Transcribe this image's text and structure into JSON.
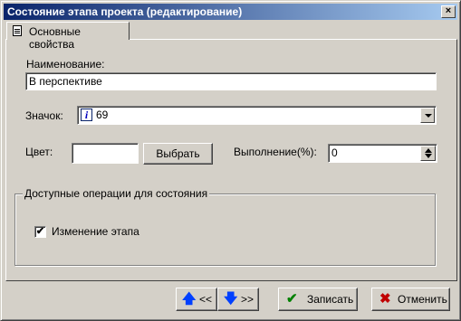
{
  "window": {
    "title": "Состояние этапа проекта (редактирование)",
    "close_glyph": "×"
  },
  "tabs": [
    {
      "label": "Основные свойства"
    }
  ],
  "form": {
    "name_label": "Наименование:",
    "name_value": "В перспективе",
    "icon_label": "Значок:",
    "icon_glyph": "i",
    "icon_value": "69",
    "color_label": "Цвет:",
    "choose_button": "Выбрать",
    "progress_label": "Выполнение(%):",
    "progress_value": "0"
  },
  "group": {
    "title": "Доступные операции для состояния",
    "checkbox_label": "Изменение этапа",
    "checkbox_mark": "✔"
  },
  "buttons": {
    "prev_label": "<<",
    "next_label": ">>",
    "save_label": "Записать",
    "cancel_label": "Отменить"
  },
  "colors": {
    "up_arrow": "#0040ff",
    "down_arrow": "#0040ff",
    "save_check": "#008000",
    "cancel_x": "#c00000"
  },
  "icons": {
    "tab": "document-icon",
    "icon_preview": "info-icon",
    "prev": "arrow-up-icon",
    "next": "arrow-down-icon",
    "save": "checkmark-icon",
    "cancel": "x-icon"
  }
}
